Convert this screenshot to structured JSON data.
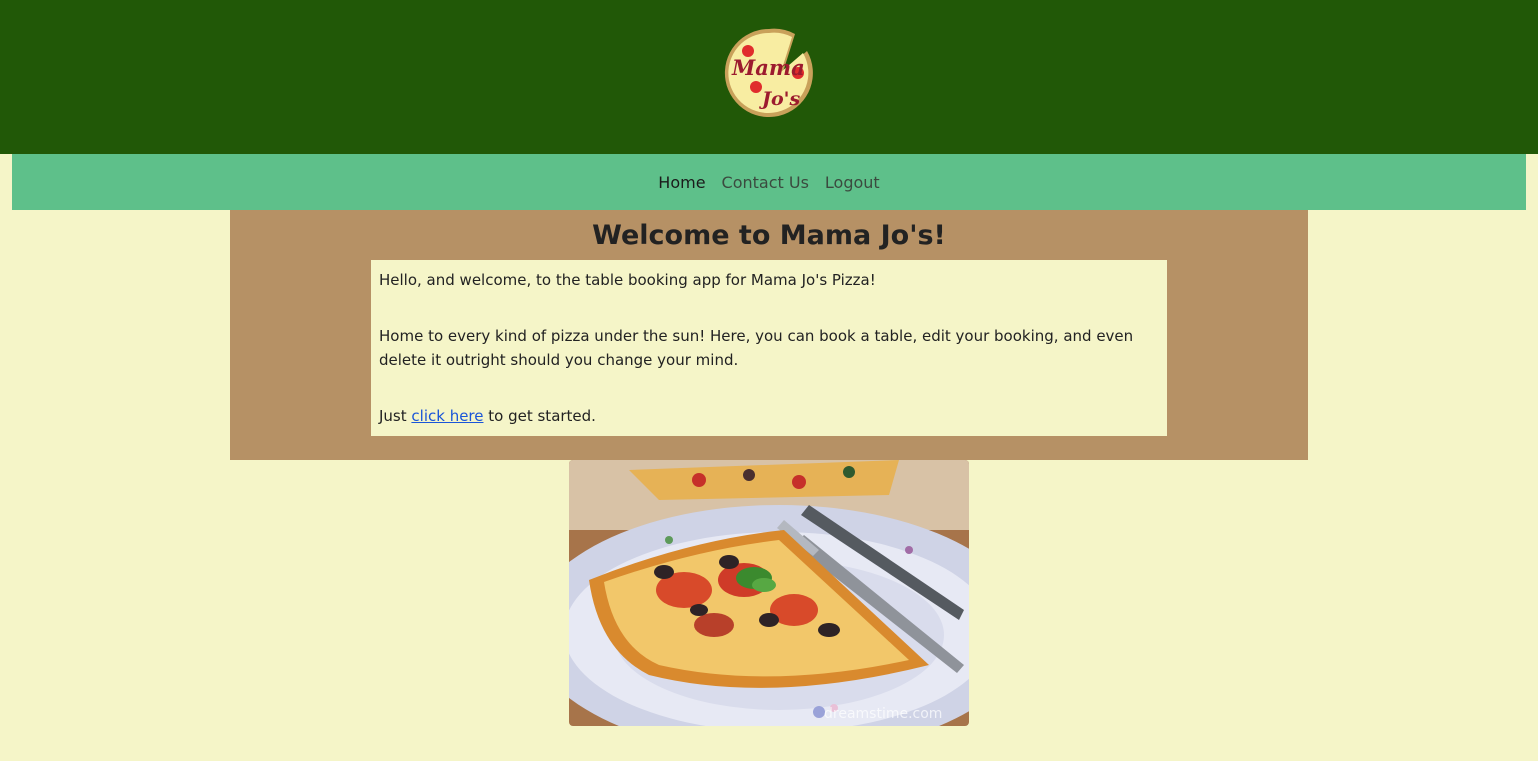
{
  "logo": {
    "line1": "Mama",
    "line2": "Jo's",
    "colors": {
      "crust": "#c9a15a",
      "cheese": "#f8eda2",
      "pepperoni": "#e02c2c",
      "text": "#9c1b2e"
    }
  },
  "nav": {
    "items": [
      {
        "label": "Home",
        "active": true
      },
      {
        "label": "Contact Us",
        "active": false
      },
      {
        "label": "Logout",
        "active": false
      }
    ]
  },
  "welcome": {
    "title": "Welcome to Mama Jo's!",
    "paragraph1": "Hello, and welcome, to the table booking app for Mama Jo's Pizza!",
    "paragraph2": "Home to every kind of pizza under the sun! Here, you can book a table, edit your booking, and even delete it outright should you change your mind.",
    "cta_prefix": "Just ",
    "cta_link": "click here",
    "cta_suffix": " to get started."
  },
  "image": {
    "watermark": "dreamstime.com"
  },
  "colors": {
    "header_bg": "#215807",
    "nav_bg": "#5ec08a",
    "page_bg": "#f5f5c8",
    "welcome_bg": "#b69165",
    "link": "#1a55d8"
  }
}
